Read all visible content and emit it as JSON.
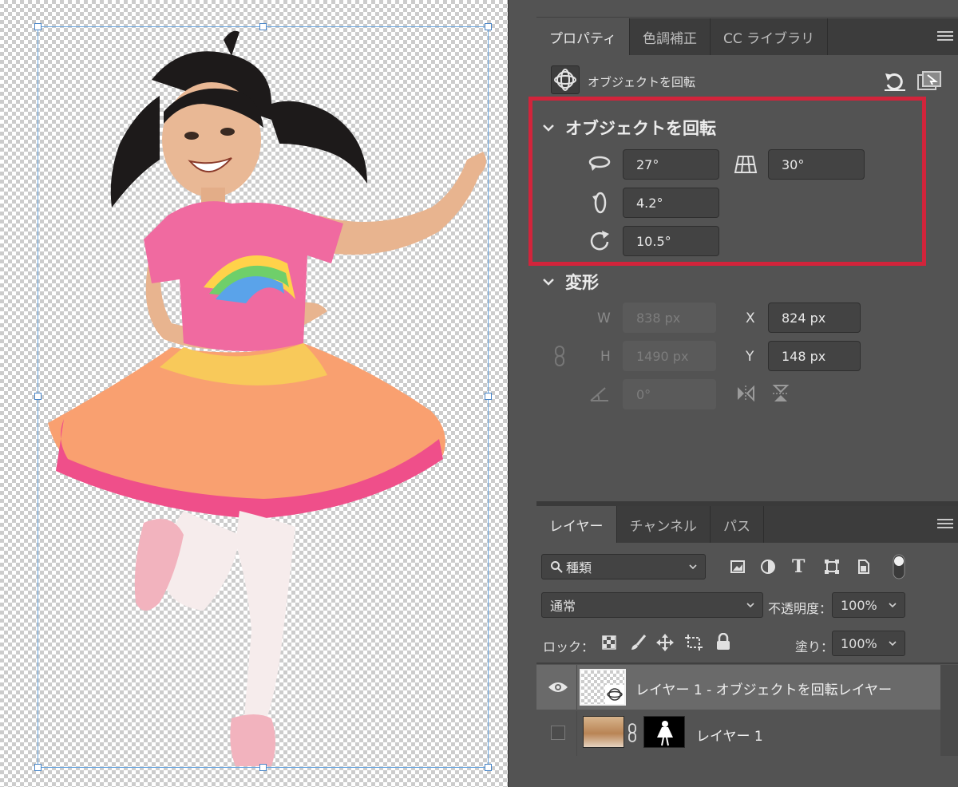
{
  "properties_panel": {
    "tabs": [
      {
        "label": "プロパティ"
      },
      {
        "label": "色調補正"
      },
      {
        "label": "CC ライブラリ"
      }
    ],
    "object_label": "オブジェクトを回転",
    "rotate_section": {
      "title": "オブジェクトを回転",
      "fields": {
        "rotate_x": "27°",
        "perspective": "30°",
        "rotate_y": "4.2°",
        "rotate_z": "10.5°"
      }
    },
    "transform_section": {
      "title": "変形",
      "w_label": "W",
      "w_value": "838 px",
      "h_label": "H",
      "h_value": "1490 px",
      "x_label": "X",
      "x_value": "824 px",
      "y_label": "Y",
      "y_value": "148 px",
      "angle_value": "0°"
    }
  },
  "layers_panel": {
    "tabs": [
      {
        "label": "レイヤー"
      },
      {
        "label": "チャンネル"
      },
      {
        "label": "パス"
      }
    ],
    "filter_label": "種類",
    "blend_mode": "通常",
    "opacity_label": "不透明度：",
    "opacity_value": "100%",
    "lock_label": "ロック：",
    "fill_label": "塗り：",
    "fill_value": "100%",
    "layers": [
      {
        "name": "レイヤー 1 - オブジェクトを回転レイヤー",
        "selected": true
      },
      {
        "name": "レイヤー 1",
        "selected": false
      }
    ]
  },
  "colors": {
    "highlight": "#d2243b",
    "panel_bg": "#535353",
    "selection": "#6aa6e0"
  }
}
